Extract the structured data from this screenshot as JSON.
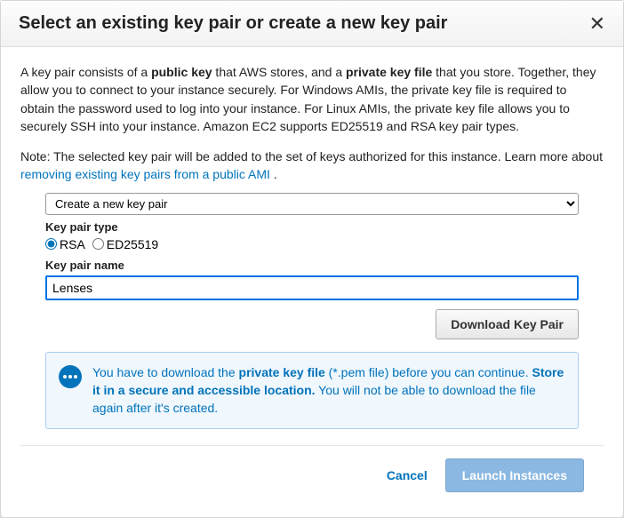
{
  "header": {
    "title": "Select an existing key pair or create a new key pair"
  },
  "description": {
    "part1": "A key pair consists of a ",
    "bold1": "public key",
    "part2": " that AWS stores, and a ",
    "bold2": "private key file",
    "part3": " that you store. Together, they allow you to connect to your instance securely. For Windows AMIs, the private key file is required to obtain the password used to log into your instance. For Linux AMIs, the private key file allows you to securely SSH into your instance. Amazon EC2 supports ED25519 and RSA key pair types."
  },
  "note": {
    "prefix": "Note: The selected key pair will be added to the set of keys authorized for this instance. Learn more about ",
    "link": "removing existing key pairs from a public AMI",
    "suffix": " ."
  },
  "form": {
    "dropdown_value": "Create a new key pair",
    "type_label": "Key pair type",
    "radio_rsa": "RSA",
    "radio_ed": "ED25519",
    "name_label": "Key pair name",
    "name_value": "Lenses",
    "download_label": "Download Key Pair"
  },
  "info": {
    "part1": "You have to download the ",
    "bold1": "private key file",
    "part2": " (*.pem file) before you can continue. ",
    "bold2": "Store it in a secure and accessible location.",
    "part3": " You will not be able to download the file again after it's created."
  },
  "footer": {
    "cancel": "Cancel",
    "launch": "Launch Instances"
  }
}
